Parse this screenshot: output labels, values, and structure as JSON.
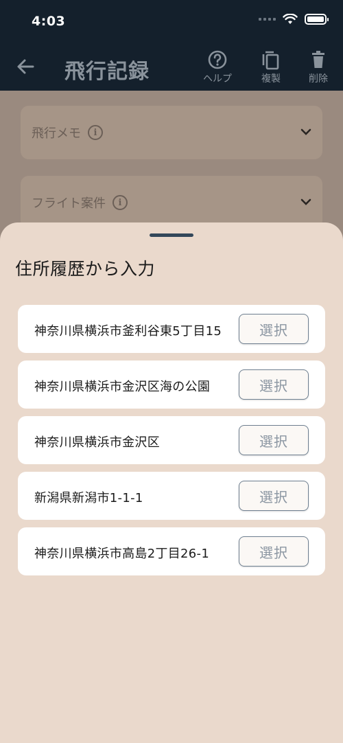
{
  "status": {
    "time": "4:03"
  },
  "appbar": {
    "title": "飛行記録",
    "actions": [
      {
        "label": "ヘルプ",
        "icon": "help-circle-icon"
      },
      {
        "label": "複製",
        "icon": "copy-icon"
      },
      {
        "label": "削除",
        "icon": "trash-icon"
      }
    ]
  },
  "background": {
    "cards": [
      {
        "label": "飛行メモ"
      },
      {
        "label": "フライト案件"
      }
    ]
  },
  "sheet": {
    "title": "住所履歴から入力",
    "select_label": "選択",
    "items": [
      {
        "address": "神奈川県横浜市釜利谷東5丁目15"
      },
      {
        "address": "神奈川県横浜市金沢区海の公園"
      },
      {
        "address": "神奈川県横浜市金沢区"
      },
      {
        "address": "新潟県新潟市1-1-1"
      },
      {
        "address": "神奈川県横浜市高島2丁目26-1"
      }
    ]
  },
  "colors": {
    "appbar_bg": "#14202c",
    "sheet_bg": "#ead9cc",
    "button_border": "#6e7f90",
    "handle": "#33475a"
  }
}
